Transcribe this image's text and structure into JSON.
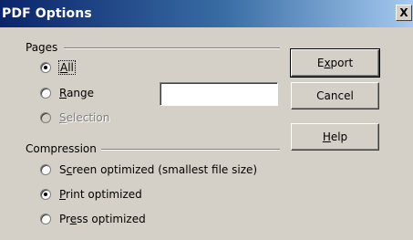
{
  "window": {
    "title": "PDF Options",
    "close_glyph": "X"
  },
  "pages_group": {
    "label": "Pages",
    "options": [
      {
        "mnemonic": "A",
        "rest": "ll",
        "checked": true,
        "disabled": false
      },
      {
        "mnemonic": "R",
        "rest": "ange",
        "checked": false,
        "disabled": false
      },
      {
        "mnemonic": "S",
        "rest": "election",
        "checked": false,
        "disabled": true
      }
    ],
    "range_value": ""
  },
  "compression_group": {
    "label": "Compression",
    "options": [
      {
        "prefix": "S",
        "mnemonic": "c",
        "rest": "reen optimized (smallest file size)",
        "checked": false
      },
      {
        "prefix": "",
        "mnemonic": "P",
        "rest": "rint optimized",
        "checked": true
      },
      {
        "prefix": "Pr",
        "mnemonic": "e",
        "rest": "ss optimized",
        "checked": false
      }
    ]
  },
  "buttons": {
    "export": {
      "prefix": "E",
      "mnemonic": "x",
      "rest": "port"
    },
    "cancel": {
      "label": "Cancel"
    },
    "help": {
      "prefix": "",
      "mnemonic": "H",
      "rest": "elp"
    }
  },
  "colors": {
    "title_gradient_start": "#0a246a",
    "title_gradient_end": "#a6caf0",
    "dialog_face": "#d4d0c8"
  }
}
